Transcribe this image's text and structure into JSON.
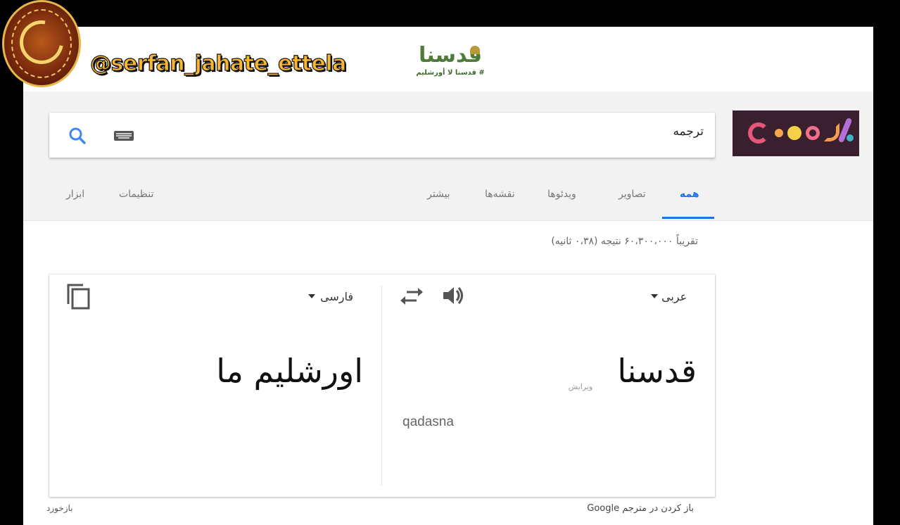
{
  "watermark": {
    "handle": "@serfan_jahate_ettela",
    "medallion_icon": "calligraphy-medallion",
    "logo_text": "قدسنا",
    "logo_subtext": "# قدسنا لا أورشليم"
  },
  "search": {
    "query": "ترجمه",
    "search_icon": "search-icon",
    "keyboard_icon": "keyboard-icon"
  },
  "doodle": {
    "label": "Google doodle"
  },
  "nav": {
    "tabs": [
      {
        "label": "همه",
        "active": true
      },
      {
        "label": "تصاویر"
      },
      {
        "label": "ویدئوها"
      },
      {
        "label": "نقشه‌ها"
      },
      {
        "label": "بیشتر"
      }
    ],
    "settings": "تنظیمات",
    "tools": "ابزار"
  },
  "result_stats": "تقریباً ۶۰،۳۰۰،۰۰۰ نتیجه (۰،۳۸ ثانیه)",
  "translate": {
    "source_lang": "عربی",
    "target_lang": "فارسی",
    "source_text": "قدسنا",
    "edit_label": "ویرایش",
    "transliteration": "qadasna",
    "target_text": "اورشلیم ما",
    "speaker_icon": "speaker-icon",
    "swap_icon": "swap-icon",
    "copy_icon": "copy-icon"
  },
  "footer": {
    "open_translate": "باز کردن در مترجم Google",
    "feedback": "بازخورد"
  },
  "colors": {
    "accent": "#1a73e8",
    "handle": "#f7b733",
    "logo_green": "#4f7b3a"
  }
}
